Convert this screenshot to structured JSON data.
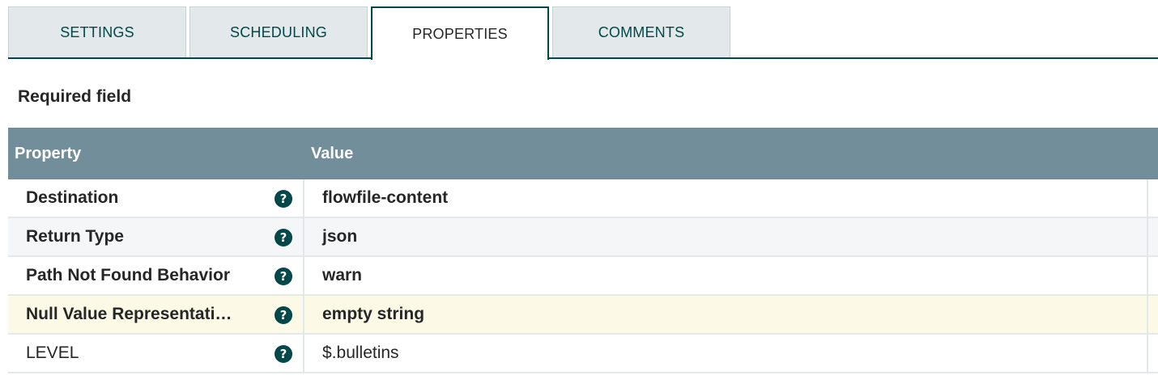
{
  "tabs": [
    {
      "label": "SETTINGS",
      "active": false
    },
    {
      "label": "SCHEDULING",
      "active": false
    },
    {
      "label": "PROPERTIES",
      "active": true
    },
    {
      "label": "COMMENTS",
      "active": false
    }
  ],
  "required_field_label": "Required field",
  "grid": {
    "headers": {
      "property": "Property",
      "value": "Value"
    },
    "rows": [
      {
        "property": "Destination",
        "value": "flowfile-content",
        "help_icon": "question-circle-icon"
      },
      {
        "property": "Return Type",
        "value": "json",
        "help_icon": "question-circle-icon"
      },
      {
        "property": "Path Not Found Behavior",
        "value": "warn",
        "help_icon": "question-circle-icon"
      },
      {
        "property": "Null Value Representati…",
        "value": "empty string",
        "help_icon": "question-circle-icon"
      },
      {
        "property": "LEVEL",
        "value": "$.bulletins",
        "help_icon": "question-circle-icon"
      }
    ]
  },
  "help_glyph": "?",
  "colors": {
    "accent": "#004849",
    "header_bg": "#728e9b",
    "tab_bg": "#e3e8eb",
    "highlight_row": "#fcf9e7"
  }
}
